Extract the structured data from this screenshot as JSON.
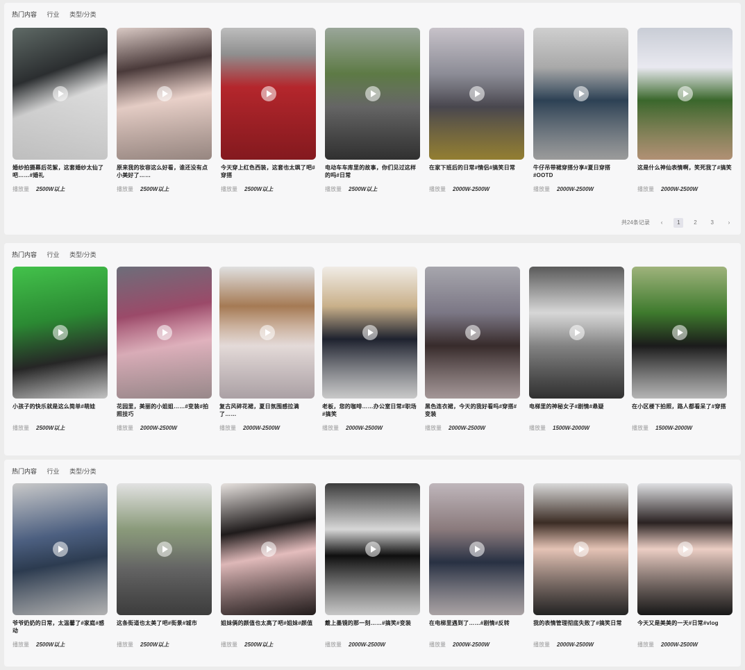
{
  "sections": [
    {
      "header": {
        "hot": "热门内容",
        "tags": [
          "行业",
          "类型/分类"
        ]
      },
      "pager": {
        "total": "共24条记录",
        "pages": [
          "1",
          "2",
          "3"
        ],
        "prev": "‹",
        "next": "›"
      },
      "items": [
        {
          "title": "婚纱拍摄幕后花絮，这套婚纱太仙了吧……#婚礼",
          "views_label": "播放量",
          "views": "2500W以上"
        },
        {
          "title": "原来我的妆容这么好看，谁还没有点小美好了……",
          "views_label": "播放量",
          "views": "2500W以上"
        },
        {
          "title": "今天穿上红色西装，这套也太飒了吧#穿搭",
          "views_label": "播放量",
          "views": "2500W以上"
        },
        {
          "title": "电动车车库里的故事，你们见过这样的吗#日常",
          "views_label": "播放量",
          "views": "2500W以上"
        },
        {
          "title": "在家下班后的日常#情侣#搞笑日常",
          "views_label": "播放量",
          "views": "2000W-2500W"
        },
        {
          "title": "牛仔吊带裙穿搭分享#夏日穿搭#OOTD",
          "views_label": "播放量",
          "views": "2000W-2500W"
        },
        {
          "title": "这是什么神仙表情啊，笑死我了#搞笑",
          "views_label": "播放量",
          "views": "2000W-2500W"
        }
      ]
    },
    {
      "header": {
        "hot": "热门内容",
        "tags": [
          "行业",
          "类型/分类"
        ]
      },
      "items": [
        {
          "title": "小孩子的快乐就是这么简单#萌娃",
          "views_label": "播放量",
          "views": "2500W以上"
        },
        {
          "title": "花园里，美丽的小姐姐……#变装#拍照技巧",
          "views_label": "播放量",
          "views": "2000W-2500W"
        },
        {
          "title": "复古风碎花裙，夏日氛围感拉满了……",
          "views_label": "播放量",
          "views": "2000W-2500W"
        },
        {
          "title": "老板，您的咖啡……办公室日常#职场#搞笑",
          "views_label": "播放量",
          "views": "2000W-2500W"
        },
        {
          "title": "黑色连衣裙，今天的我好看吗#穿搭#变装",
          "views_label": "播放量",
          "views": "2000W-2500W"
        },
        {
          "title": "电梯里的神秘女子#剧情#悬疑",
          "views_label": "播放量",
          "views": "1500W-2000W"
        },
        {
          "title": "在小区楼下拍照，路人都看呆了#穿搭",
          "views_label": "播放量",
          "views": "1500W-2000W"
        }
      ]
    },
    {
      "header": {
        "hot": "热门内容",
        "tags": [
          "行业",
          "类型/分类"
        ]
      },
      "items": [
        {
          "title": "爷爷奶奶的日常，太温馨了#家庭#感动",
          "views_label": "播放量",
          "views": "2500W以上"
        },
        {
          "title": "这条街道也太美了吧#街景#城市",
          "views_label": "播放量",
          "views": "2500W以上"
        },
        {
          "title": "姐妹俩的颜值也太高了吧#姐妹#颜值",
          "views_label": "播放量",
          "views": "2500W以上"
        },
        {
          "title": "戴上墨镜的那一刻……#搞笑#变装",
          "views_label": "播放量",
          "views": "2000W-2500W"
        },
        {
          "title": "在电梯里遇到了……#剧情#反转",
          "views_label": "播放量",
          "views": "2000W-2500W"
        },
        {
          "title": "我的表情管理彻底失败了#搞笑日常",
          "views_label": "播放量",
          "views": "2000W-2500W"
        },
        {
          "title": "今天又是美美的一天#日常#vlog",
          "views_label": "播放量",
          "views": "2000W-2500W"
        }
      ]
    }
  ],
  "icons": {
    "play": "play-icon"
  }
}
